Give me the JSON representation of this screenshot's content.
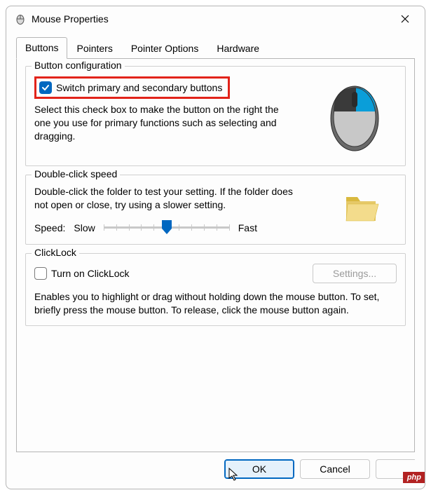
{
  "window": {
    "title": "Mouse Properties"
  },
  "tabs": {
    "buttons": "Buttons",
    "pointers": "Pointers",
    "pointer_options": "Pointer Options",
    "hardware": "Hardware"
  },
  "button_config": {
    "group_title": "Button configuration",
    "switch_label": "Switch primary and secondary buttons",
    "switch_checked": true,
    "description": "Select this check box to make the button on the right the one you use for primary functions such as selecting and dragging."
  },
  "double_click": {
    "group_title": "Double-click speed",
    "description": "Double-click the folder to test your setting. If the folder does not open or close, try using a slower setting.",
    "speed_label": "Speed:",
    "slow_label": "Slow",
    "fast_label": "Fast"
  },
  "clicklock": {
    "group_title": "ClickLock",
    "turn_on_label": "Turn on ClickLock",
    "settings_label": "Settings...",
    "description": "Enables you to highlight or drag without holding down the mouse button. To set, briefly press the mouse button. To release, click the mouse button again."
  },
  "dialog": {
    "ok": "OK",
    "cancel": "Cancel"
  },
  "badge": "php"
}
